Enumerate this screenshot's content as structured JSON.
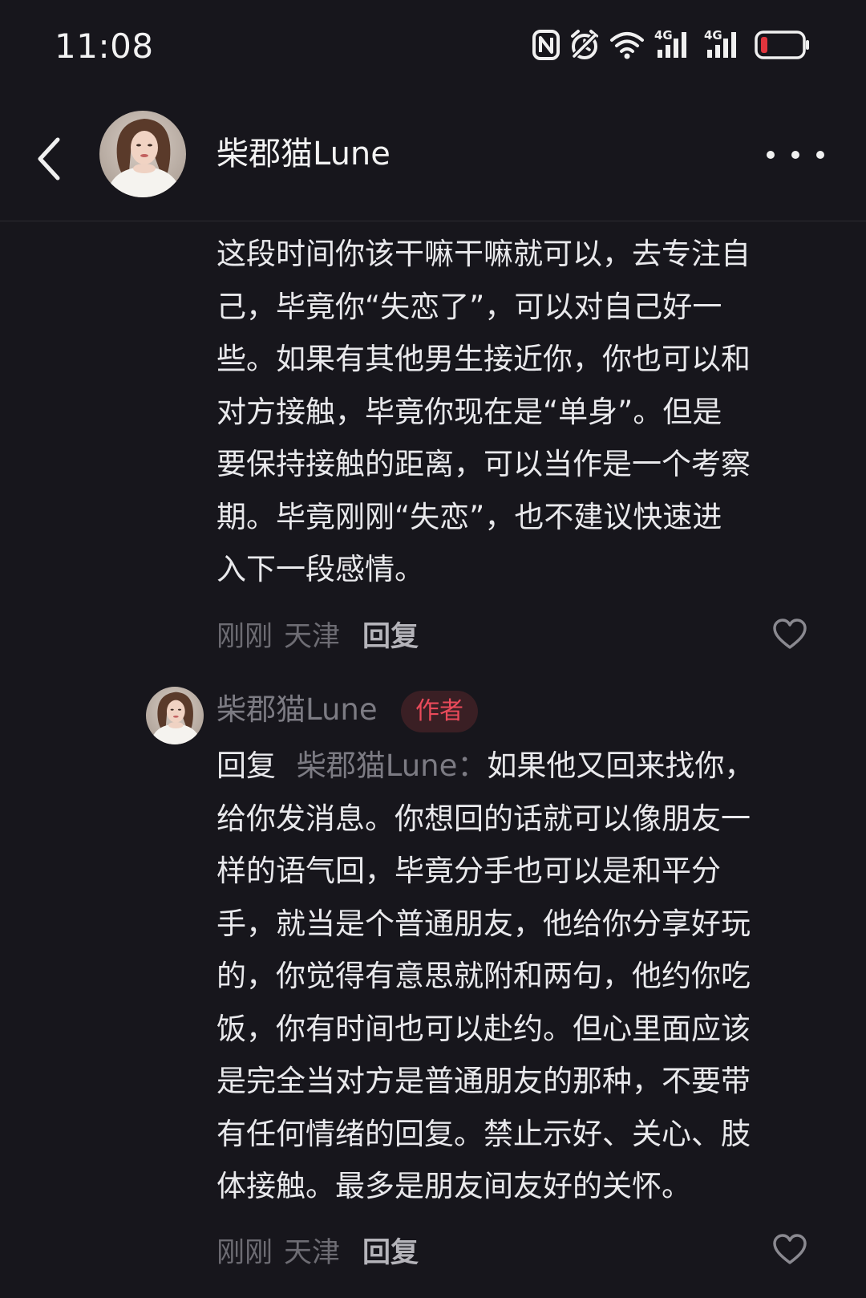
{
  "status_bar": {
    "time": "11:08",
    "icons": [
      "nfc-icon",
      "alarm-icon",
      "wifi-icon",
      "signal-4g-icon",
      "signal-4g-icon",
      "battery-low-icon"
    ],
    "network_label_1": "4G",
    "network_label_2": "4G",
    "battery_color": "#e0353d"
  },
  "header": {
    "back_icon": "chevron-left-icon",
    "username": "柴郡猫Lune",
    "more_icon": "more-horizontal-icon"
  },
  "comments": [
    {
      "text": "这段时间你该干嘛干嘛就可以，去专注自己，毕竟你“失恋了”，可以对自己好一些。如果有其他男生接近你，你也可以和对方接触，毕竟你现在是“单身”。但是要保持接触的距离，可以当作是一个考察期。毕竟刚刚“失恋”，也不建议快速进入下一段感情。",
      "lines": [
        "这段时间你该干嘛干嘛就可以，去专注自",
        "己，毕竟你“失恋了”，可以对自己好一",
        "些。如果有其他男生接近你，你也可以和",
        "对方接触，毕竟你现在是“单身”。但是",
        "要保持接触的距离，可以当作是一个考察",
        "期。毕竟刚刚“失恋”，也不建议快速进",
        "入下一段感情。"
      ],
      "time": "刚刚",
      "location": "天津",
      "reply_label": "回复",
      "like_icon": "heart-outline-icon"
    },
    {
      "author": "柴郡猫Lune",
      "badge": "作者",
      "reply_prefix": "回复",
      "reply_target": "柴郡猫Lune：",
      "lines": [
        "如果他又回来找你，",
        "给你发消息。你想回的话就可以像朋友一",
        "样的语气回，毕竟分手也可以是和平分",
        "手，就当是个普通朋友，他给你分享好玩",
        "的，你觉得有意思就附和两句，他约你吃",
        "饭，你有时间也可以赴约。但心里面应该",
        "是完全当对方是普通朋友的那种，不要带",
        "有任何情绪的回复。禁止示好、关心、肢",
        "体接触。最多是朋友间友好的关怀。"
      ],
      "time": "刚刚",
      "location": "天津",
      "reply_label": "回复",
      "like_icon": "heart-outline-icon"
    }
  ],
  "colors": {
    "background": "#17161c",
    "text_primary": "#e9e9ec",
    "text_muted": "#6d6c73",
    "badge_text": "#ea4a5a",
    "badge_bg": "#3a1f24"
  }
}
